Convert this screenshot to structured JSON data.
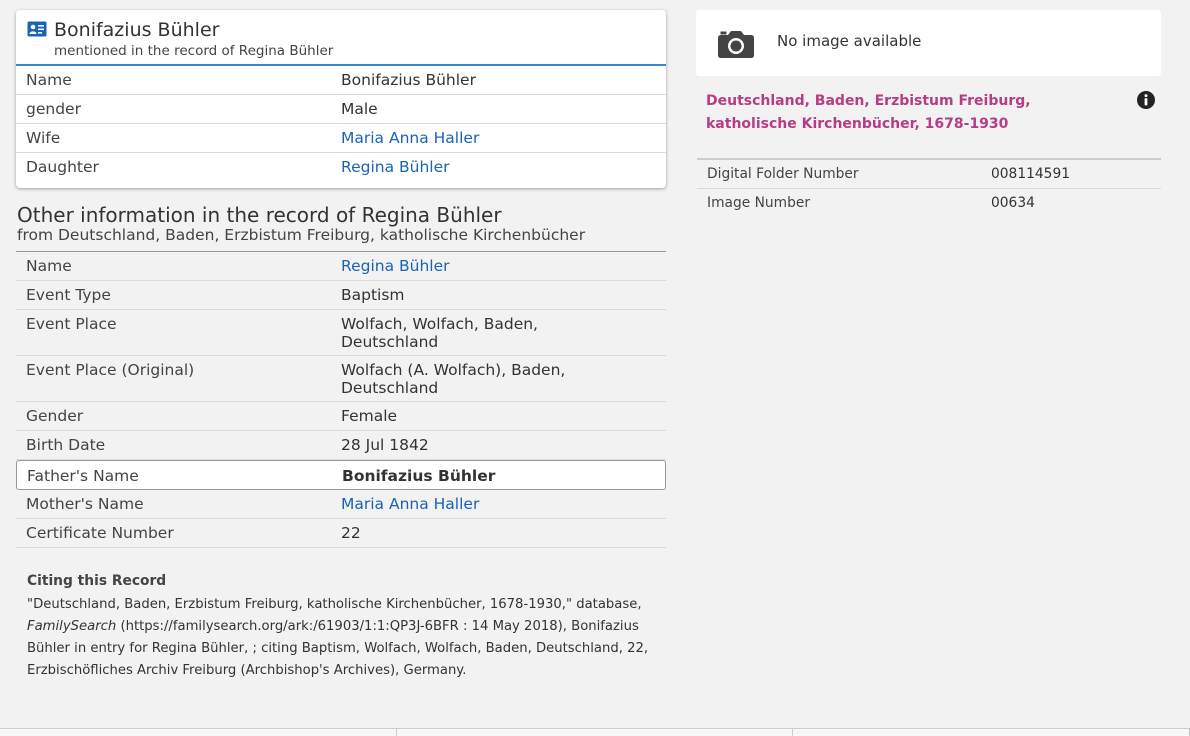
{
  "person": {
    "name": "Bonifazius Bühler",
    "subtitle": "mentioned in the record of Regina Bühler",
    "rows": [
      {
        "label": "Name",
        "value": "Bonifazius Bühler"
      },
      {
        "label": "gender",
        "value": "Male"
      },
      {
        "label": "Wife",
        "value": "Maria Anna Haller"
      },
      {
        "label": "Daughter",
        "value": "Regina Bühler"
      }
    ]
  },
  "other": {
    "title": "Other information in the record of Regina Bühler",
    "subtitle": "from Deutschland, Baden, Erzbistum Freiburg, katholische Kirchenbücher",
    "rows": [
      {
        "label": "Name",
        "value": "Regina Bühler"
      },
      {
        "label": "Event Type",
        "value": "Baptism"
      },
      {
        "label": "Event Place",
        "value": "Wolfach, Wolfach, Baden, Deutschland"
      },
      {
        "label": "Event Place (Original)",
        "value": "Wolfach (A. Wolfach), Baden, Deutschland"
      },
      {
        "label": "Gender",
        "value": "Female"
      },
      {
        "label": "Birth Date",
        "value": "28 Jul 1842"
      },
      {
        "label": "Father's Name",
        "value": "Bonifazius Bühler"
      },
      {
        "label": "Mother's Name",
        "value": "Maria Anna Haller"
      },
      {
        "label": "Certificate Number",
        "value": "22"
      }
    ]
  },
  "citation": {
    "title": "Citing this Record",
    "part1": "\"Deutschland, Baden, Erzbistum Freiburg, katholische Kirchenbücher, 1678-1930,\" database, ",
    "site": "FamilySearch",
    "part2": " (https://familysearch.org/ark:/61903/1:1:QP3J-6BFR : 14 May 2018), Bonifazius Bühler in entry for Regina Bühler, ; citing Baptism, Wolfach, Wolfach, Baden, Deutschland, 22, Erzbischöfliches Archiv Freiburg (Archbishop's Archives), Germany."
  },
  "image_panel": {
    "no_image": "No image available",
    "camera_icon": "camera-icon"
  },
  "collection": {
    "title": "Deutschland, Baden, Erzbistum Freiburg, katholische Kirchenbücher, 1678-1930",
    "info_icon": "info-icon"
  },
  "folder": {
    "rows": [
      {
        "label": "Digital Folder Number",
        "value": "008114591"
      },
      {
        "label": "Image Number",
        "value": "00634"
      }
    ]
  },
  "colors": {
    "link": "#1a63b5",
    "collection": "#b53d83",
    "header_border": "#3b86cf"
  }
}
